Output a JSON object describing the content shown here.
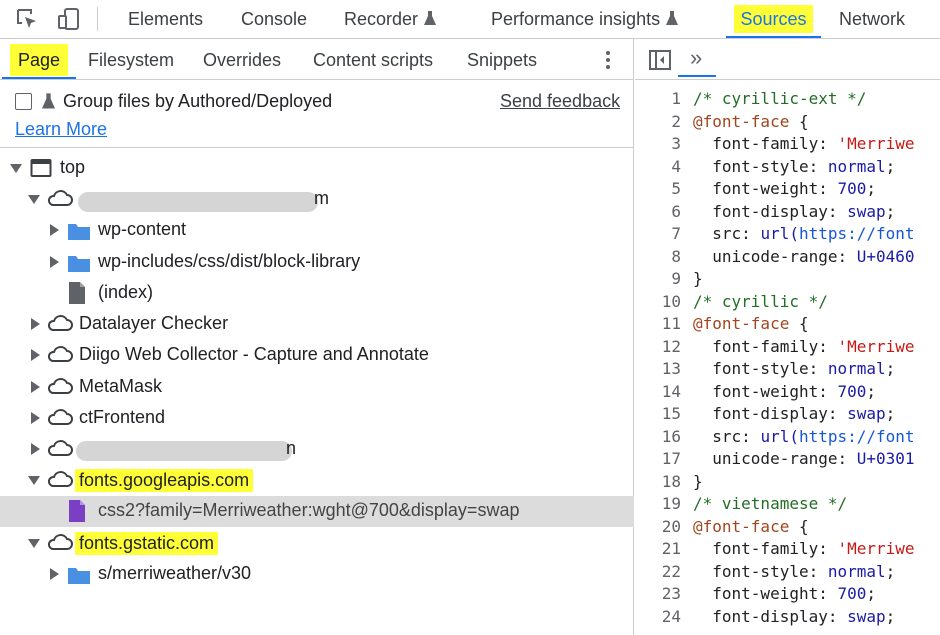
{
  "toolbar": {
    "tabs": [
      {
        "label": "Elements"
      },
      {
        "label": "Console"
      },
      {
        "label": "Recorder"
      },
      {
        "label": "Performance insights"
      },
      {
        "label": "Sources"
      },
      {
        "label": "Network"
      }
    ],
    "active_tab": "Sources"
  },
  "sources": {
    "subtabs": [
      {
        "label": "Page"
      },
      {
        "label": "Filesystem"
      },
      {
        "label": "Overrides"
      },
      {
        "label": "Content scripts"
      },
      {
        "label": "Snippets"
      }
    ],
    "active_subtab": "Page",
    "group_checkbox_label": "Group files by Authored/Deployed",
    "group_checkbox_checked": false,
    "send_feedback": "Send feedback",
    "learn_more": "Learn More",
    "tree": [
      {
        "label": "top"
      },
      {
        "label": "m"
      },
      {
        "label": "wp-content"
      },
      {
        "label": "wp-includes/css/dist/block-library"
      },
      {
        "label": "(index)"
      },
      {
        "label": "Datalayer Checker"
      },
      {
        "label": "Diigo Web Collector - Capture and Annotate"
      },
      {
        "label": "MetaMask"
      },
      {
        "label": "ctFrontend"
      },
      {
        "label": "n"
      },
      {
        "label": "fonts.googleapis.com"
      },
      {
        "label": "css2?family=Merriweather:wght@700&display=swap"
      },
      {
        "label": "fonts.gstatic.com"
      },
      {
        "label": "s/merriweather/v30"
      }
    ]
  },
  "editor": {
    "expand_label": "»",
    "lines": [
      {
        "n": "1",
        "text": "/* cyrillic-ext */"
      },
      {
        "n": "2",
        "text": "@font-face {"
      },
      {
        "n": "3",
        "text": "  font-family: 'Merriwe"
      },
      {
        "n": "4",
        "text": "  font-style: normal;"
      },
      {
        "n": "5",
        "text": "  font-weight: 700;"
      },
      {
        "n": "6",
        "text": "  font-display: swap;"
      },
      {
        "n": "7",
        "text": "  src: url(https://font"
      },
      {
        "n": "8",
        "text": "  unicode-range: U+0460"
      },
      {
        "n": "9",
        "text": "}"
      },
      {
        "n": "10",
        "text": "/* cyrillic */"
      },
      {
        "n": "11",
        "text": "@font-face {"
      },
      {
        "n": "12",
        "text": "  font-family: 'Merriwe"
      },
      {
        "n": "13",
        "text": "  font-style: normal;"
      },
      {
        "n": "14",
        "text": "  font-weight: 700;"
      },
      {
        "n": "15",
        "text": "  font-display: swap;"
      },
      {
        "n": "16",
        "text": "  src: url(https://font"
      },
      {
        "n": "17",
        "text": "  unicode-range: U+0301"
      },
      {
        "n": "18",
        "text": "}"
      },
      {
        "n": "19",
        "text": "/* vietnamese */"
      },
      {
        "n": "20",
        "text": "@font-face {"
      },
      {
        "n": "21",
        "text": "  font-family: 'Merriwe"
      },
      {
        "n": "22",
        "text": "  font-style: normal;"
      },
      {
        "n": "23",
        "text": "  font-weight: 700;"
      },
      {
        "n": "24",
        "text": "  font-display: swap;"
      }
    ]
  },
  "colors": {
    "accent": "#1a73e8",
    "highlight": "#ffff38",
    "folder": "#4a90e2",
    "script_file": "#7b3fc4"
  }
}
